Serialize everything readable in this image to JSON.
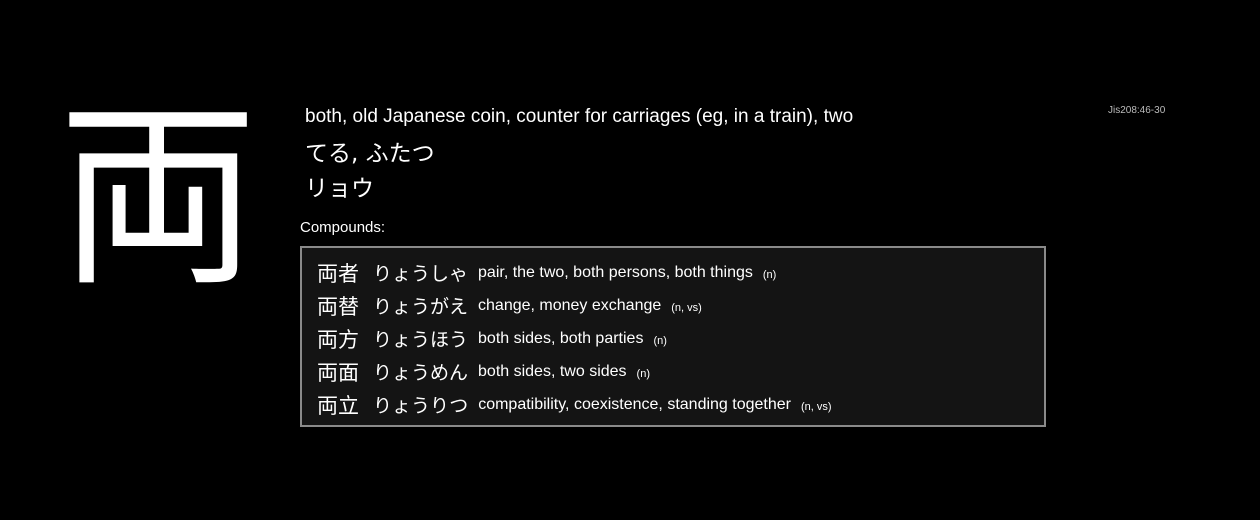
{
  "kanji": {
    "character": "両",
    "meaning": "both, old Japanese coin, counter for carriages (eg, in a train), two",
    "kun_reading": "てる, ふたつ",
    "on_reading": "リョウ",
    "jis_code": "Jis208:46-30"
  },
  "compounds": {
    "label": "Compounds:",
    "items": [
      {
        "word": "両者",
        "reading": "りょうしゃ",
        "meaning": "pair, the two, both persons, both things",
        "pos": "(n)"
      },
      {
        "word": "両替",
        "reading": "りょうがえ",
        "meaning": "change, money exchange",
        "pos": "(n, vs)"
      },
      {
        "word": "両方",
        "reading": "りょうほう",
        "meaning": "both sides, both parties",
        "pos": "(n)"
      },
      {
        "word": "両面",
        "reading": "りょうめん",
        "meaning": "both sides, two sides",
        "pos": "(n)"
      },
      {
        "word": "両立",
        "reading": "りょうりつ",
        "meaning": "compatibility, coexistence, standing together",
        "pos": "(n, vs)"
      }
    ]
  },
  "colors": {
    "background": "#000000",
    "text": "#ffffff",
    "box_background": "#141414",
    "box_border": "#8a8a8a"
  }
}
